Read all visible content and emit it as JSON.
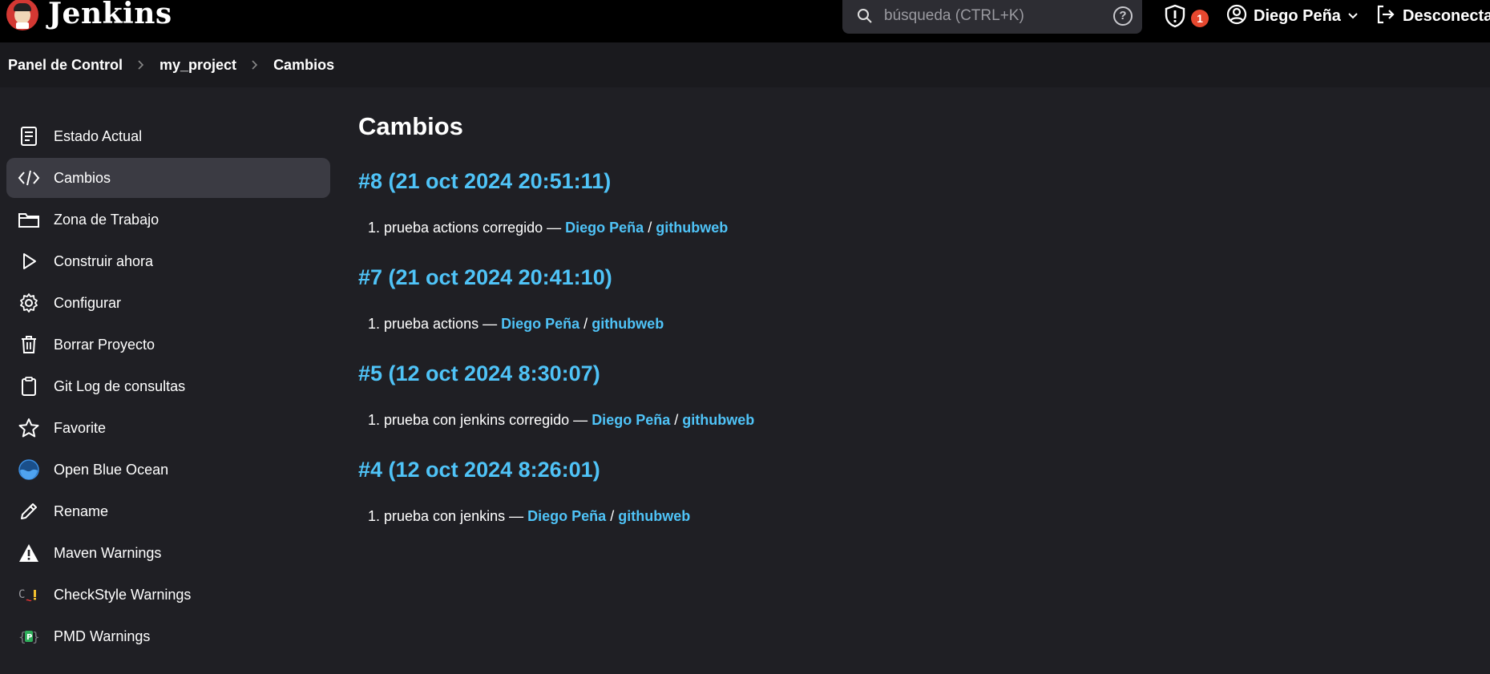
{
  "header": {
    "brand": "Jenkins",
    "search_placeholder": "búsqueda (CTRL+K)",
    "help": "?",
    "security_count": "1",
    "user_name": "Diego Peña",
    "logout": "Desconectar"
  },
  "breadcrumb": [
    "Panel de Control",
    "my_project",
    "Cambios"
  ],
  "sidebar": {
    "items": [
      {
        "label": "Estado Actual",
        "icon": "document-icon"
      },
      {
        "label": "Cambios",
        "icon": "code-icon",
        "active": true
      },
      {
        "label": "Zona de Trabajo",
        "icon": "folder-icon"
      },
      {
        "label": "Construir ahora",
        "icon": "play-icon"
      },
      {
        "label": "Configurar",
        "icon": "gear-icon"
      },
      {
        "label": "Borrar Proyecto",
        "icon": "trash-icon"
      },
      {
        "label": "Git Log de consultas",
        "icon": "clipboard-icon"
      },
      {
        "label": "Favorite",
        "icon": "star-icon"
      },
      {
        "label": "Open Blue Ocean",
        "icon": "blue-ocean-icon"
      },
      {
        "label": "Rename",
        "icon": "pencil-icon"
      },
      {
        "label": "Maven Warnings",
        "icon": "warning-icon"
      },
      {
        "label": "CheckStyle Warnings",
        "icon": "checkstyle-icon"
      },
      {
        "label": "PMD Warnings",
        "icon": "pmd-icon"
      }
    ]
  },
  "main": {
    "title": "Cambios",
    "builds": [
      {
        "title": "#8 (21 oct 2024 20:51:11)",
        "num": "1.",
        "message": "prueba actions corregido",
        "author": "Diego Peña",
        "repo": "githubweb"
      },
      {
        "title": "#7 (21 oct 2024 20:41:10)",
        "num": "1.",
        "message": "prueba actions",
        "author": "Diego Peña",
        "repo": "githubweb"
      },
      {
        "title": "#5 (12 oct 2024 8:30:07)",
        "num": "1.",
        "message": "prueba con jenkins corregido",
        "author": "Diego Peña",
        "repo": "githubweb"
      },
      {
        "title": "#4 (12 oct 2024 8:26:01)",
        "num": "1.",
        "message": "prueba con jenkins",
        "author": "Diego Peña",
        "repo": "githubweb"
      }
    ],
    "separator": "—",
    "slash": "/"
  },
  "colors": {
    "accent_link": "#4fc3f7",
    "background": "#1f1f24",
    "header_bg": "#000000",
    "badge": "#e6482f"
  }
}
